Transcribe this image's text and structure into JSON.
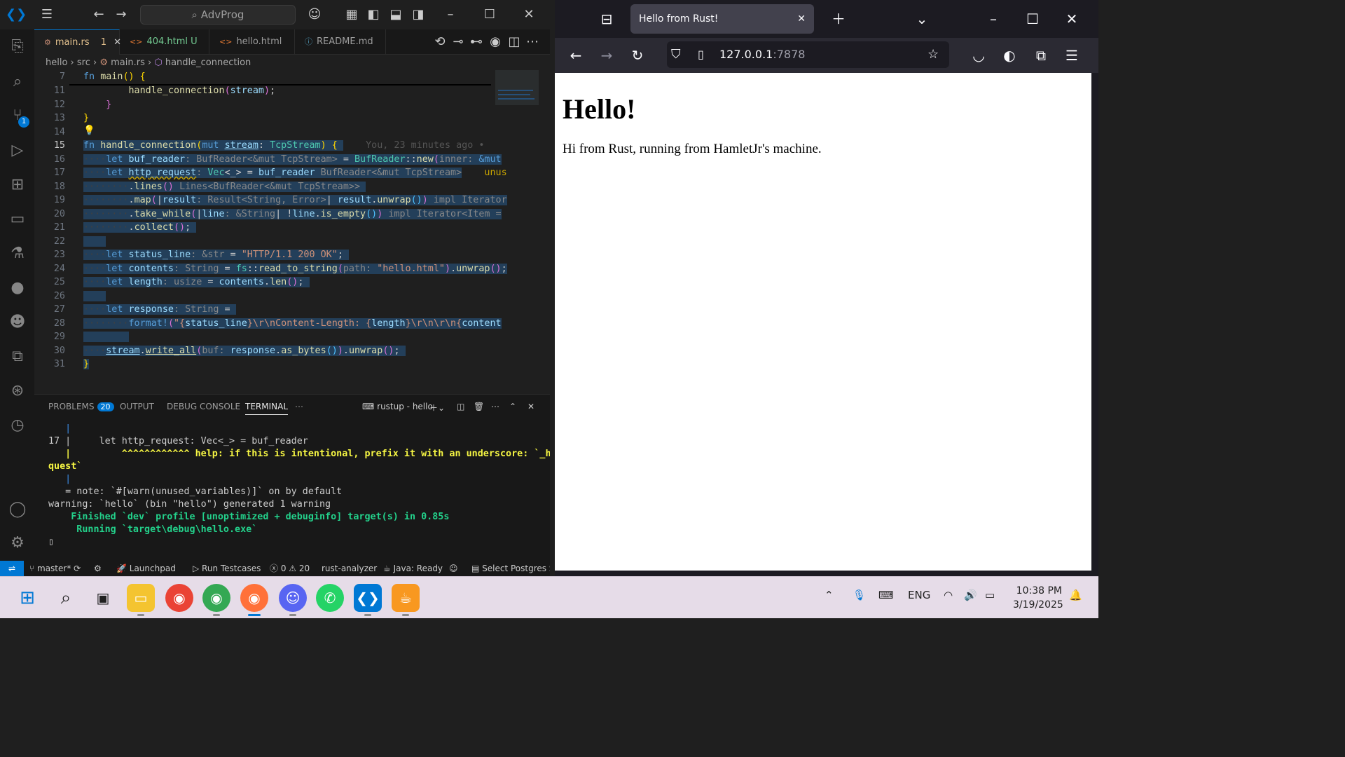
{
  "vscode": {
    "search_text": "AdvProg",
    "tabs": [
      {
        "label": "main.rs",
        "suffix": "1"
      },
      {
        "label": "404.html",
        "suffix": "U"
      },
      {
        "label": "hello.html",
        "suffix": ""
      },
      {
        "label": "README.md",
        "suffix": ""
      }
    ],
    "breadcrumb": [
      "hello",
      "src",
      "main.rs",
      "handle_connection"
    ],
    "line_numbers": [
      "7",
      "11",
      "12",
      "13",
      "14",
      "15",
      "16",
      "17",
      "18",
      "19",
      "20",
      "21",
      "22",
      "23",
      "24",
      "25",
      "26",
      "27",
      "28",
      "29",
      "30",
      "31"
    ],
    "blame": "You, 23 minutes ago •",
    "panel": {
      "tabs": [
        "PROBLEMS",
        "OUTPUT",
        "DEBUG CONSOLE",
        "TERMINAL"
      ],
      "problems_count": "20",
      "terminal_name": "rustup - hello"
    },
    "terminal_lines": [
      "   |",
      "17 |     let http_request: Vec<_> = buf_reader",
      "   |         ^^^^^^^^^^^^ help: if this is intentional, prefix it with an underscore: `_http_re",
      "quest`",
      "   |",
      "   = note: `#[warn(unused_variables)]` on by default",
      "",
      "warning: `hello` (bin \"hello\") generated 1 warning",
      "    Finished `dev` profile [unoptimized + debuginfo] target(s) in 0.85s",
      "     Running `target\\debug\\hello.exe`"
    ],
    "status": {
      "branch": "master*",
      "launchpad": "Launchpad",
      "testcases": "Run Testcases",
      "errors": "0",
      "warnings": "20",
      "analyzer": "rust-analyzer",
      "java": "Java: Ready",
      "postgres": "Select Postgres S"
    }
  },
  "firefox": {
    "tab_title": "Hello from Rust!",
    "url_host": "127.0.0.1",
    "url_port": ":7878",
    "heading": "Hello!",
    "paragraph": "Hi from Rust, running from HamletJr's machine."
  },
  "taskbar": {
    "lang": "ENG",
    "time": "10:38 PM",
    "date": "3/19/2025"
  },
  "colors": {
    "accent": "#0078d4",
    "editor_bg": "#1f1f1f",
    "browser_chrome": "#1c1b22",
    "taskbar": "#e6dce8"
  }
}
